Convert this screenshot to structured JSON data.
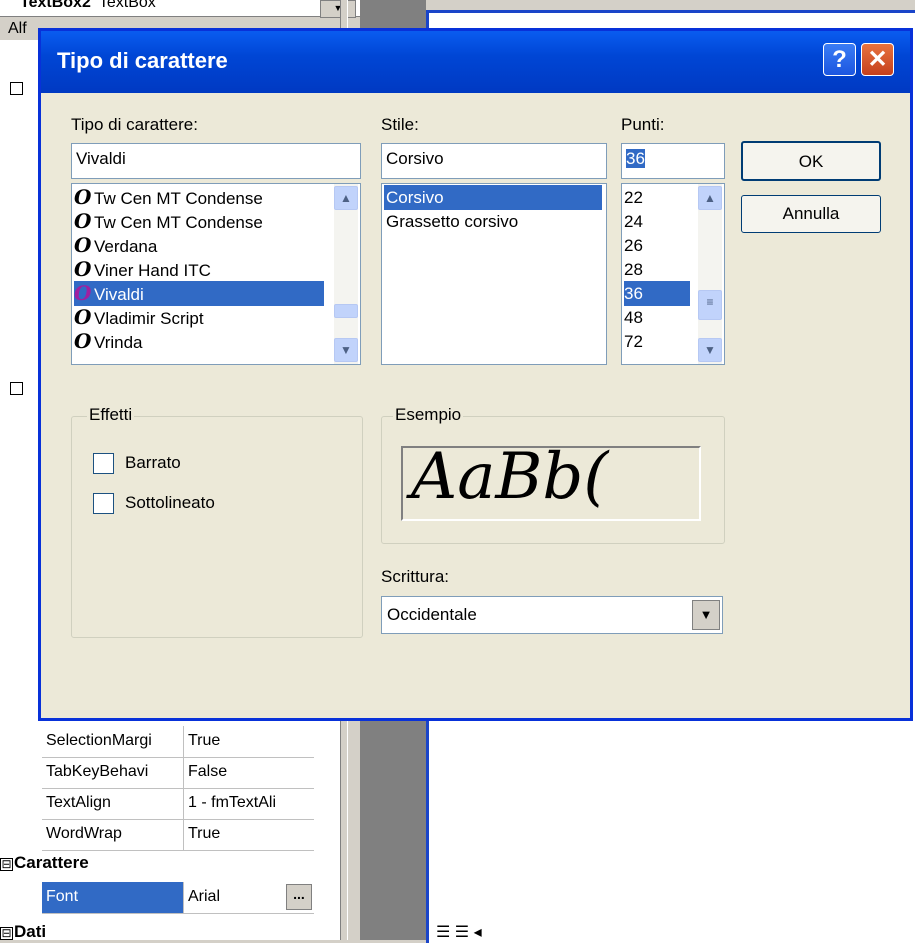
{
  "background": {
    "top_control_name": "TextBox2",
    "top_control_type": "TextBox",
    "tab_label": "Alf",
    "property_rows": [
      {
        "name": "SelectionMargi",
        "value": "True"
      },
      {
        "name": "TabKeyBehavi",
        "value": "False"
      },
      {
        "name": "TextAlign",
        "value": "1 - fmTextAli"
      },
      {
        "name": "WordWrap",
        "value": "True"
      }
    ],
    "category_carattere": "Carattere",
    "font_row": {
      "name": "Font",
      "value": "Arial",
      "button": "..."
    },
    "category_dati": "Dati",
    "expander_symbol": "⊟"
  },
  "dialog": {
    "title": "Tipo di carattere",
    "help_button": "?",
    "close_button": "✕",
    "font_label": "Tipo di carattere:",
    "font_value": "Vivaldi",
    "font_list": [
      "Tw Cen MT Condense",
      "Tw Cen MT Condense",
      "Verdana",
      "Viner Hand ITC",
      "Vivaldi",
      "Vladimir Script",
      "Vrinda"
    ],
    "font_selected_index": 4,
    "style_label": "Stile:",
    "style_value": "Corsivo",
    "style_list": [
      "Corsivo",
      "Grassetto corsivo"
    ],
    "style_selected_index": 0,
    "size_label": "Punti:",
    "size_value": "36",
    "size_list": [
      "22",
      "24",
      "26",
      "28",
      "36",
      "48",
      "72"
    ],
    "size_selected_index": 4,
    "ok_button": "OK",
    "cancel_button": "Annulla",
    "effects_label": "Effetti",
    "strikeout_label": "Barrato",
    "underline_label": "Sottolineato",
    "sample_label": "Esempio",
    "sample_text": "AaBb(",
    "script_label": "Scrittura:",
    "script_value": "Occidentale",
    "colors": {
      "title_bar": "#0046d5",
      "selection": "#316ac5",
      "dialog_bg": "#ece9d8"
    }
  }
}
